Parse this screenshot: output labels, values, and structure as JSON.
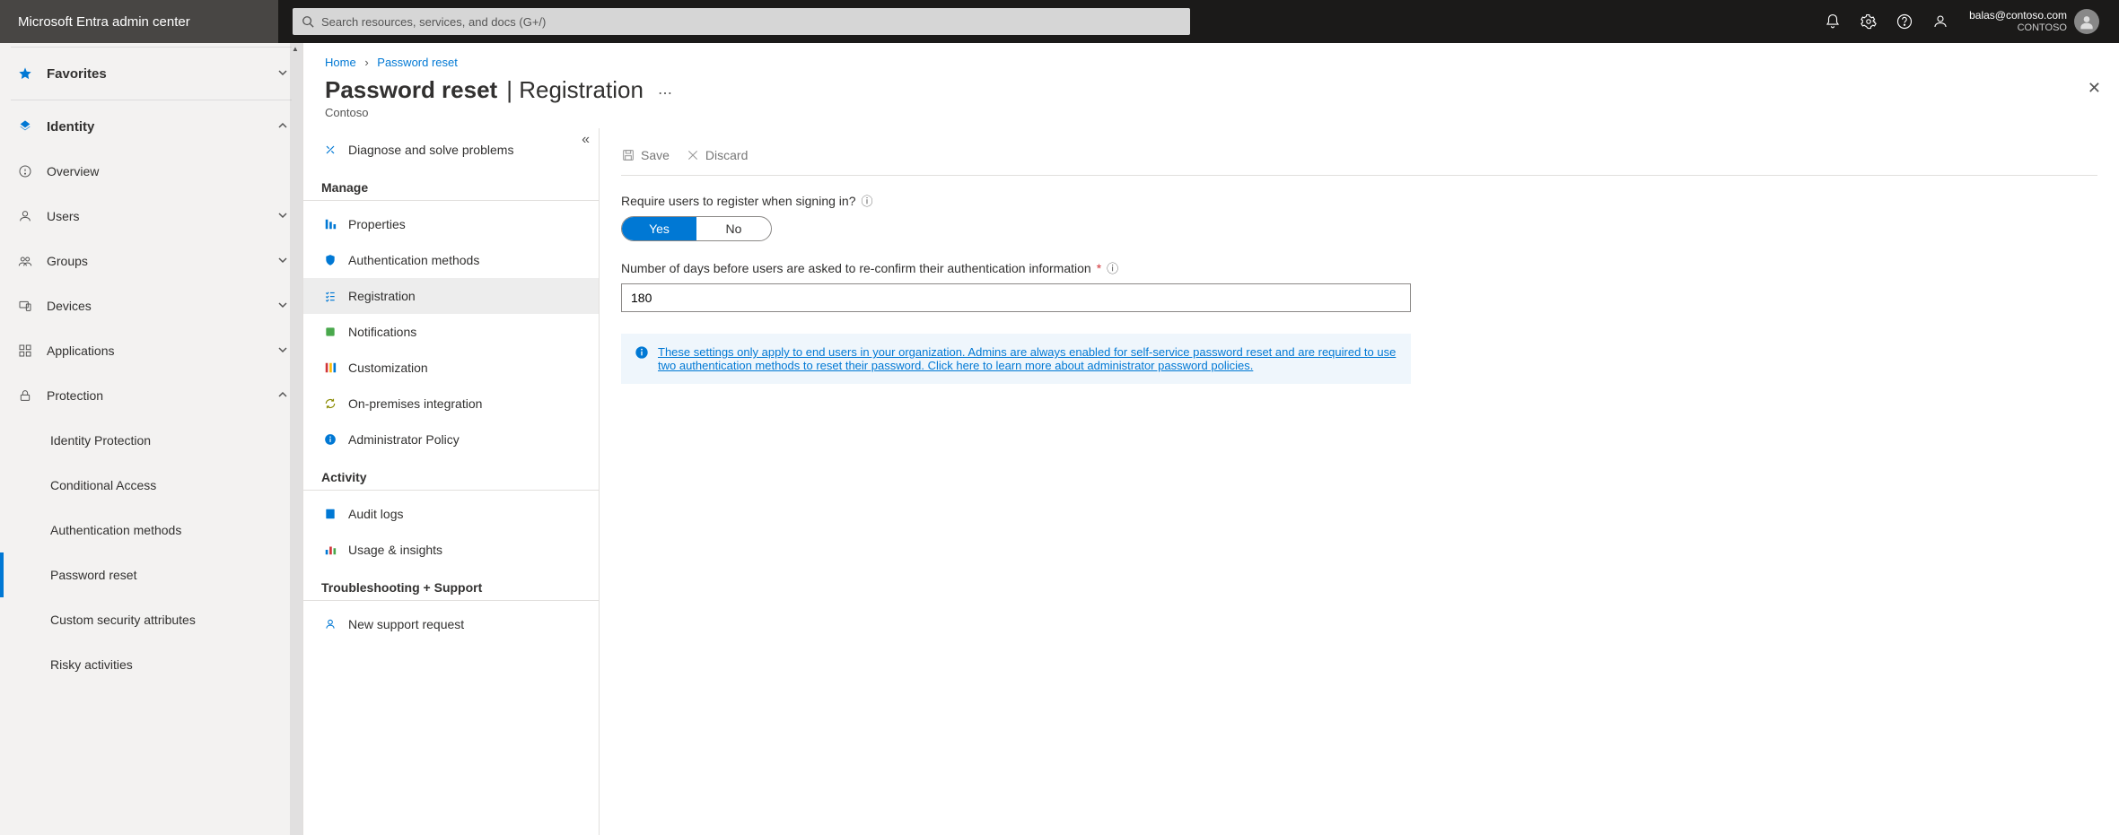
{
  "header": {
    "product": "Microsoft Entra admin center",
    "search_placeholder": "Search resources, services, and docs (G+/)",
    "user_email": "balas@contoso.com",
    "org": "CONTOSO"
  },
  "sidebar": {
    "favorites": "Favorites",
    "identity": "Identity",
    "items": [
      {
        "label": "Overview"
      },
      {
        "label": "Users"
      },
      {
        "label": "Groups"
      },
      {
        "label": "Devices"
      },
      {
        "label": "Applications"
      },
      {
        "label": "Protection"
      }
    ],
    "protection_subs": [
      {
        "label": "Identity Protection"
      },
      {
        "label": "Conditional Access"
      },
      {
        "label": "Authentication methods"
      },
      {
        "label": "Password reset"
      },
      {
        "label": "Custom security attributes"
      },
      {
        "label": "Risky activities"
      }
    ]
  },
  "breadcrumb": {
    "home": "Home",
    "current": "Password reset"
  },
  "page": {
    "title": "Password reset",
    "section": "Registration",
    "tenant": "Contoso"
  },
  "bladeNav": {
    "diagnose": "Diagnose and solve problems",
    "manage": "Manage",
    "manage_items": [
      {
        "label": "Properties"
      },
      {
        "label": "Authentication methods"
      },
      {
        "label": "Registration"
      },
      {
        "label": "Notifications"
      },
      {
        "label": "Customization"
      },
      {
        "label": "On-premises integration"
      },
      {
        "label": "Administrator Policy"
      }
    ],
    "activity": "Activity",
    "activity_items": [
      {
        "label": "Audit logs"
      },
      {
        "label": "Usage & insights"
      }
    ],
    "troubleshoot": "Troubleshooting + Support",
    "troubleshoot_items": [
      {
        "label": "New support request"
      }
    ]
  },
  "commands": {
    "save": "Save",
    "discard": "Discard"
  },
  "form": {
    "q1": "Require users to register when signing in?",
    "yes": "Yes",
    "no": "No",
    "q2": "Number of days before users are asked to re-confirm their authentication information",
    "days_value": "180",
    "info": "These settings only apply to end users in your organization. Admins are always enabled for self-service password reset and are required to use two authentication methods to reset their password. Click here to learn more about administrator password policies."
  }
}
